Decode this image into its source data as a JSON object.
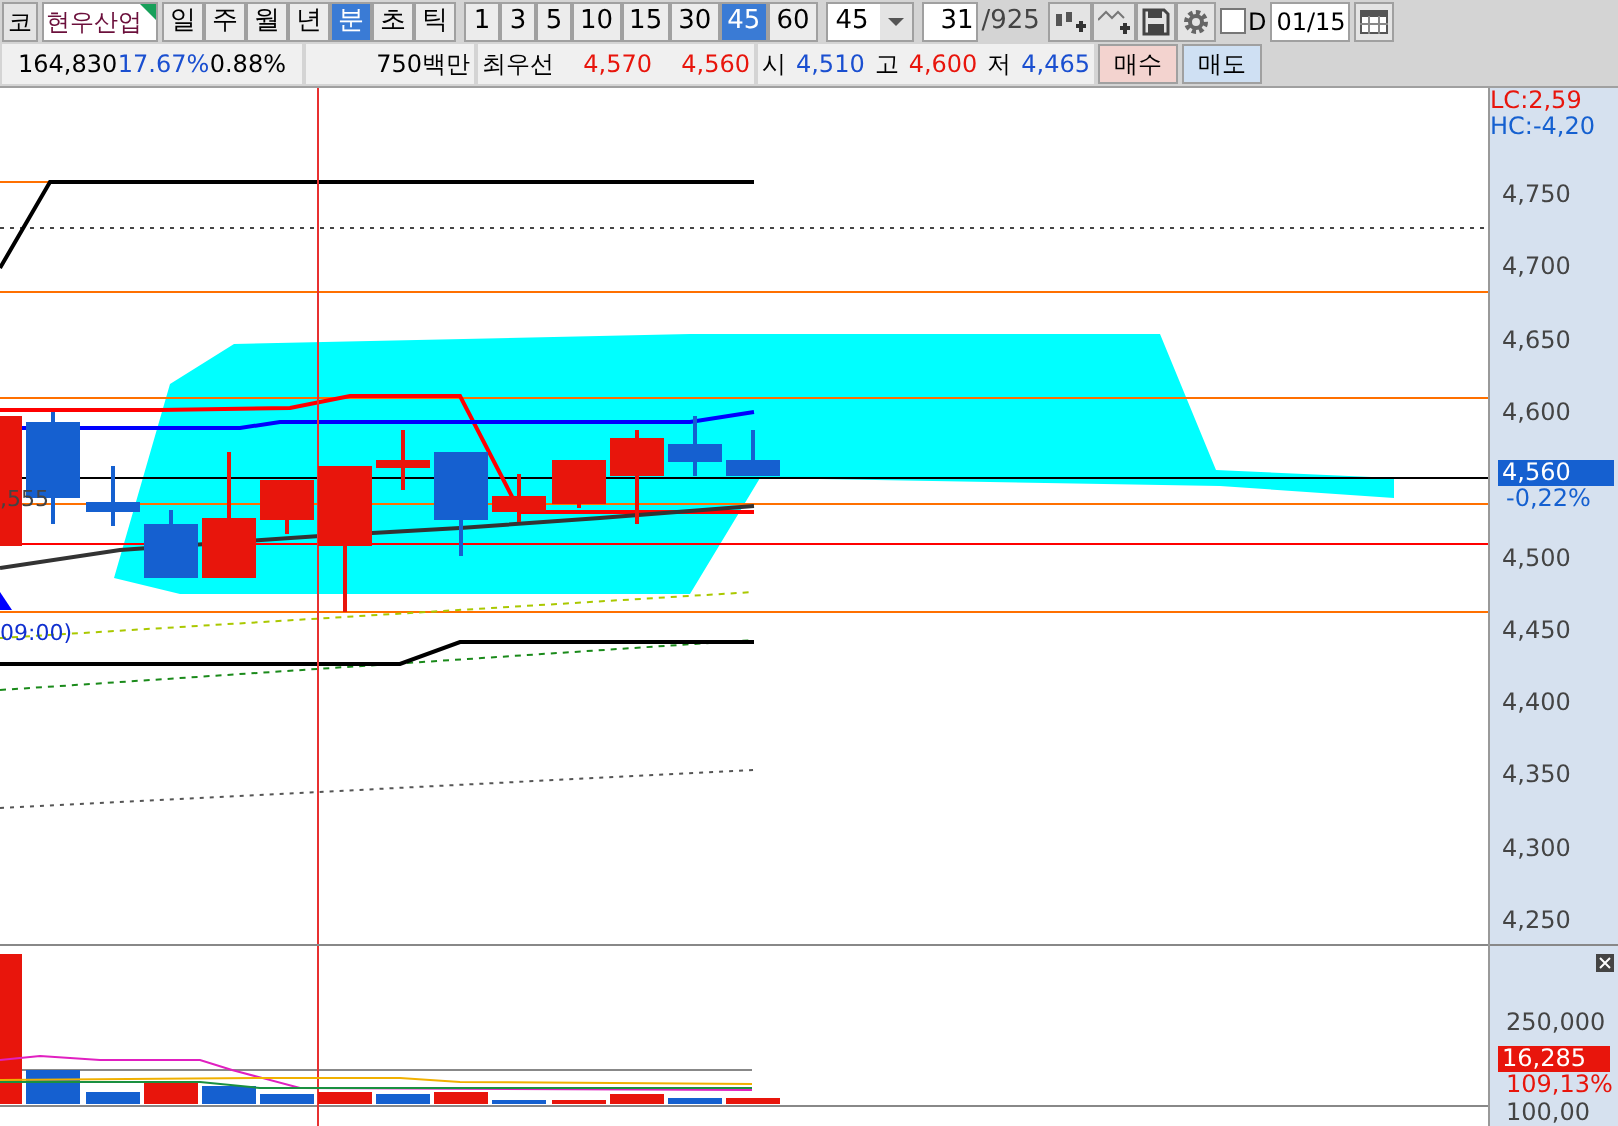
{
  "toolbar": {
    "code_button": "코",
    "stock_name": "현우산업",
    "periods": [
      {
        "label": "일",
        "selected": false
      },
      {
        "label": "주",
        "selected": false
      },
      {
        "label": "월",
        "selected": false
      },
      {
        "label": "년",
        "selected": false
      },
      {
        "label": "분",
        "selected": true
      },
      {
        "label": "초",
        "selected": false
      },
      {
        "label": "틱",
        "selected": false
      }
    ],
    "intervals": [
      {
        "label": "1",
        "selected": false
      },
      {
        "label": "3",
        "selected": false
      },
      {
        "label": "5",
        "selected": false
      },
      {
        "label": "10",
        "selected": false
      },
      {
        "label": "15",
        "selected": false
      },
      {
        "label": "30",
        "selected": false
      },
      {
        "label": "45",
        "selected": true
      },
      {
        "label": "60",
        "selected": false
      }
    ],
    "interval_select": "45",
    "count_field": "31",
    "count_total": "/925",
    "d_checkbox": {
      "label": "D",
      "checked": false
    },
    "date_field": "01/15"
  },
  "quote_bar": {
    "volume": "164,830",
    "change_rate": "17.67%",
    "ratio": "0.88%",
    "amount": "750백만",
    "best_label": "최우선",
    "best_ask": "4,570",
    "best_bid": "4,560",
    "open_label": "시",
    "open": "4,510",
    "high_label": "고",
    "high": "4,600",
    "low_label": "저",
    "low": "4,465",
    "buy_button": "매수",
    "sell_button": "매도"
  },
  "price_chart": {
    "line_label": ",555",
    "time_label": "09:00)",
    "lc": "LC:2,59",
    "hc": "HC:-4,20",
    "ticks": [
      "4,750",
      "4,700",
      "4,650",
      "4,600",
      "4,500",
      "4,450",
      "4,400",
      "4,350",
      "4,300",
      "4,250"
    ],
    "current_price": "4,560",
    "current_change": "-0,22%"
  },
  "volume_chart": {
    "tick": "250,000",
    "current_volume": "16,285",
    "volume_ratio": "109,13%",
    "next_pane_tick": "100,00"
  }
}
